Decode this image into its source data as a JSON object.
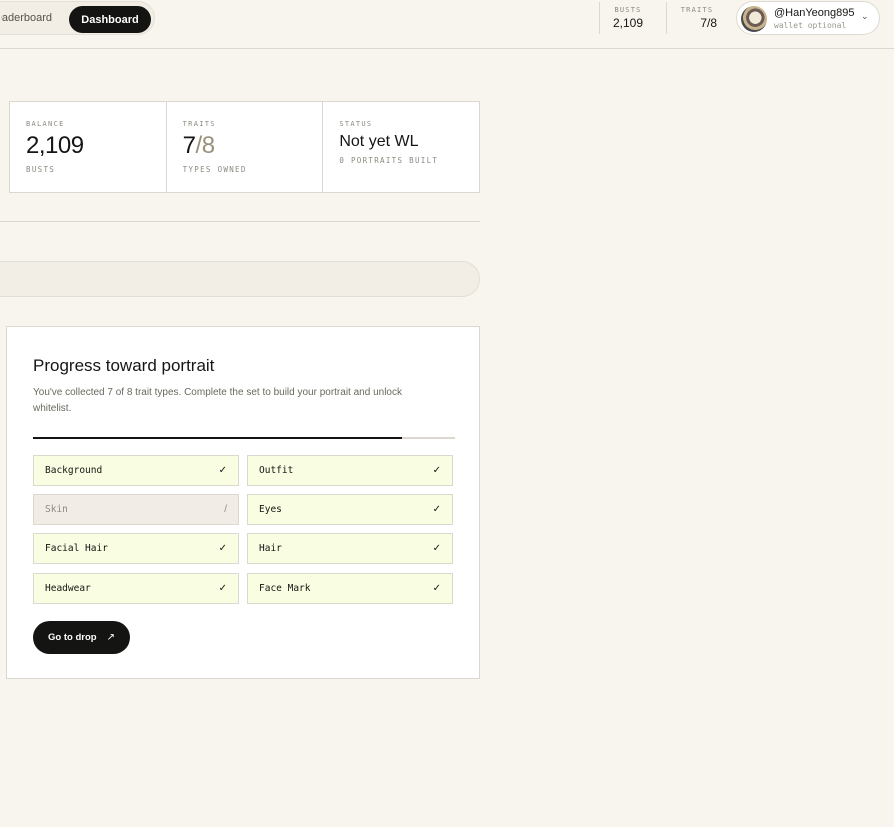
{
  "header": {
    "nav_partial": "eaderboard",
    "nav_active": "Dashboard",
    "busts_label": "BUSTS",
    "busts_value": "2,109",
    "traits_label": "TRAITS",
    "traits_value": "7/8",
    "user_name": "@HanYeong895",
    "user_sub": "wallet optional"
  },
  "stats": {
    "balance_label": "BALANCE",
    "balance_value": "2,109",
    "balance_sub": "BUSTS",
    "traits_label": "TRAITS",
    "traits_owned": "7",
    "traits_total": "/8",
    "traits_sub": "TYPES OWNED",
    "status_label": "STATUS",
    "status_value": "Not yet WL",
    "status_sub": "0 PORTRAITS BUILT"
  },
  "progress": {
    "title": "Progress toward portrait",
    "description": "You've collected 7 of 8 trait types. Complete the set to build your portrait and unlock whitelist.",
    "fraction": 0.875,
    "traits": [
      {
        "name": "Background",
        "mark": "✓",
        "owned": true
      },
      {
        "name": "Outfit",
        "mark": "✓",
        "owned": true
      },
      {
        "name": "Skin",
        "mark": "/",
        "owned": false
      },
      {
        "name": "Eyes",
        "mark": "✓",
        "owned": true
      },
      {
        "name": "Facial Hair",
        "mark": "✓",
        "owned": true
      },
      {
        "name": "Hair",
        "mark": "✓",
        "owned": true
      },
      {
        "name": "Headwear",
        "mark": "✓",
        "owned": true
      },
      {
        "name": "Face Mark",
        "mark": "✓",
        "owned": true
      }
    ],
    "cta_label": "Go to drop",
    "cta_icon": "↗"
  },
  "colors": {
    "background": "#f8f5ee",
    "accent_dark": "#141412",
    "owned_fill": "#f9fde2",
    "missing_fill": "#f1ede6"
  }
}
